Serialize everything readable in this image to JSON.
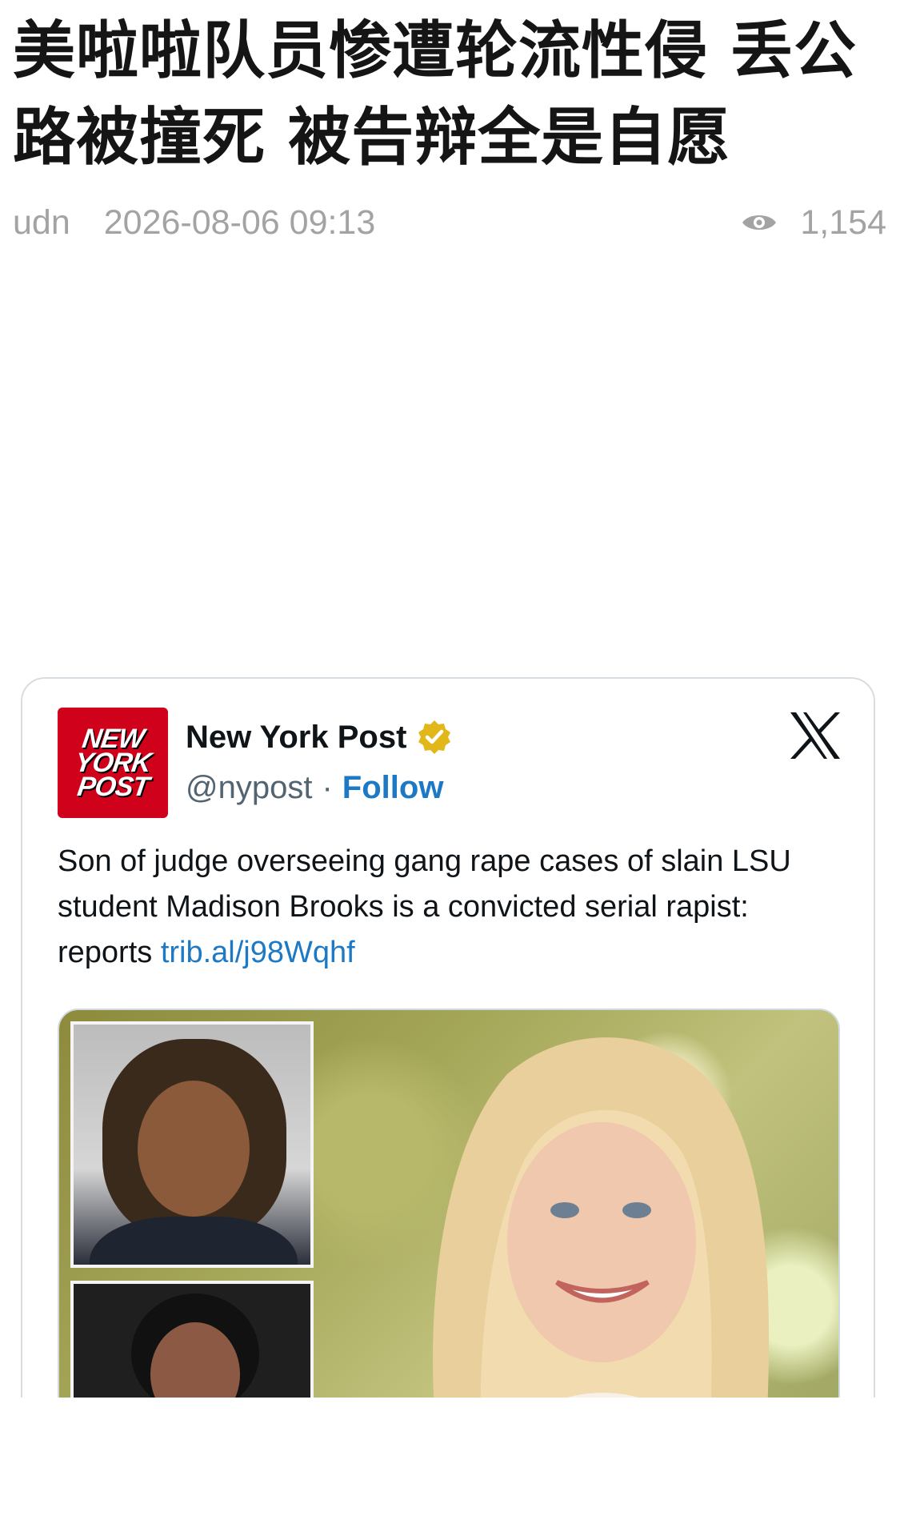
{
  "article": {
    "headline": "美啦啦队员惨遭轮流性侵 丢公路被撞死 被告辩全是自愿",
    "source": "udn",
    "datetime": "2026-08-06 09:13",
    "views": "1,154"
  },
  "tweet": {
    "account_name": "New York Post",
    "handle": "@nypost",
    "separator": "·",
    "follow_label": "Follow",
    "avatar_text": [
      "NEW",
      "YORK",
      "POST"
    ],
    "text": "Son of judge overseeing gang rape cases of slain LSU student Madison Brooks is a convicted serial rapist: reports ",
    "link": "trib.al/j98Wqhf",
    "icons": {
      "verified": "verified-badge-icon",
      "platform": "x-logo-icon",
      "views": "eye-icon"
    }
  },
  "colors": {
    "link_blue": "#1d79c4",
    "verified_gold": "#e2b719",
    "brand_red": "#d0021b",
    "meta_gray": "#a3a3a3"
  }
}
